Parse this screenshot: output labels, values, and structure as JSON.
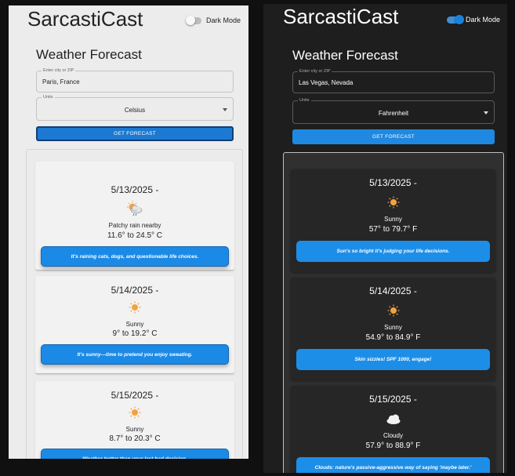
{
  "light": {
    "app_title": "SarcastiCast",
    "dark_mode_label": "Dark Mode",
    "section_title": "Weather Forecast",
    "city_label": "Enter city or ZIP",
    "city_value": "Paris, France",
    "units_label": "Units",
    "units_value": "Celsius",
    "get_forecast_label": "GET FORECAST",
    "cards": [
      {
        "date": "5/13/2025 -",
        "icon": "patchy-rain-icon",
        "condition": "Patchy rain nearby",
        "temps": "11.6° to 24.5° C",
        "quip": "It's raining cats, dogs, and questionable life choices."
      },
      {
        "date": "5/14/2025 -",
        "icon": "sun-icon",
        "condition": "Sunny",
        "temps": "9° to 19.2° C",
        "quip": "It's sunny—time to pretend you enjoy sweating."
      },
      {
        "date": "5/15/2025 -",
        "icon": "sun-icon",
        "condition": "Sunny",
        "temps": "8.7° to 20.3° C",
        "quip": "Weather hotter than your last bad decision."
      }
    ]
  },
  "dark": {
    "app_title": "SarcastiCast",
    "dark_mode_label": "Dark Mode",
    "section_title": "Weather Forecast",
    "city_label": "Enter city or ZIP",
    "city_value": "Las Vegas, Nevada",
    "units_label": "Units",
    "units_value": "Fahrenheit",
    "get_forecast_label": "GET FORECAST",
    "cards": [
      {
        "date": "5/13/2025 -",
        "icon": "sun-icon",
        "condition": "Sunny",
        "temps": "57° to 79.7° F",
        "quip": "Sun's so bright it's judging your life decisions."
      },
      {
        "date": "5/14/2025 -",
        "icon": "sun-icon",
        "condition": "Sunny",
        "temps": "54.9° to 84.9° F",
        "quip": "Skin sizzles! SPF 1000, engage!"
      },
      {
        "date": "5/15/2025 -",
        "icon": "cloud-icon",
        "condition": "Cloudy",
        "temps": "57.9° to 88.9° F",
        "quip": "Clouds: nature's passive-aggressive way of saying 'maybe later.'"
      }
    ]
  },
  "colors": {
    "accent": "#1c79d2",
    "quip_blue": "#1b8ae6",
    "sun": "#f2a341"
  }
}
